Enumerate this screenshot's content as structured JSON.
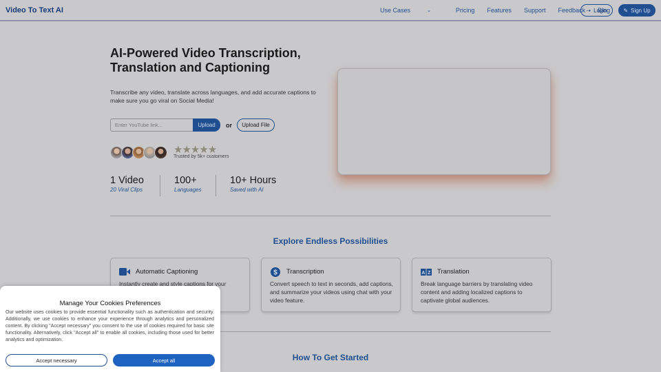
{
  "nav": {
    "brand": "Video To Text AI",
    "links": [
      "Use Cases",
      "Pricing",
      "Features",
      "Support",
      "Feedback",
      "Blog"
    ],
    "login": "Login",
    "signup": "Sign Up"
  },
  "hero": {
    "title": "AI-Powered Video Transcription, Translation and Captioning",
    "description": "Transcribe any video, translate across languages, and add accurate captions to make sure you go viral on Social Media!",
    "input_placeholder": "Enter YouTube link...",
    "upload_button": "Upload",
    "or": "or",
    "upload_file_button": "Upload File",
    "rating": 5,
    "trusted": "Trusted by 5k+ customers",
    "stats": [
      {
        "value": "1 Video",
        "label": "20 Viral Clips"
      },
      {
        "value": "100+",
        "label": "Languages"
      },
      {
        "value": "10+ Hours",
        "label": "Saved with AI"
      }
    ]
  },
  "explore": {
    "title": "Explore Endless Possibilities",
    "cards": [
      {
        "title": "Automatic Captioning",
        "text": "Instantly create and style captions for your",
        "icon": "video-camera-icon"
      },
      {
        "title": "Transcription",
        "text": "Convert speech to text in seconds, add captions, and summarize your videos using chat with your video feature.",
        "icon": "dollar-icon"
      },
      {
        "title": "Translation",
        "text": "Break language barriers by translating video content and adding localized captions to captivate global audiences.",
        "icon": "translate-icon"
      }
    ]
  },
  "get_started": {
    "title": "How To Get Started"
  },
  "cookie": {
    "title": "Manage Your Cookies Preferences",
    "text": "Our website uses cookies to provide essential functionality such as authentication and security. Additionally, we use cookies to enhance your experience through analytics and personalized content. By clicking \"Accept necessary\" you consent to the use of cookies required for basic site functionality. Alternatively, click \"Accept all\" to enable all cookies, including those used for better analytics and optimization.",
    "accept_necessary": "Accept necessary",
    "accept_all": "Accept all"
  },
  "colors": {
    "brand": "#1f4f91",
    "accent_button": "#1f63c0",
    "video_glow": "#b95f3c"
  }
}
